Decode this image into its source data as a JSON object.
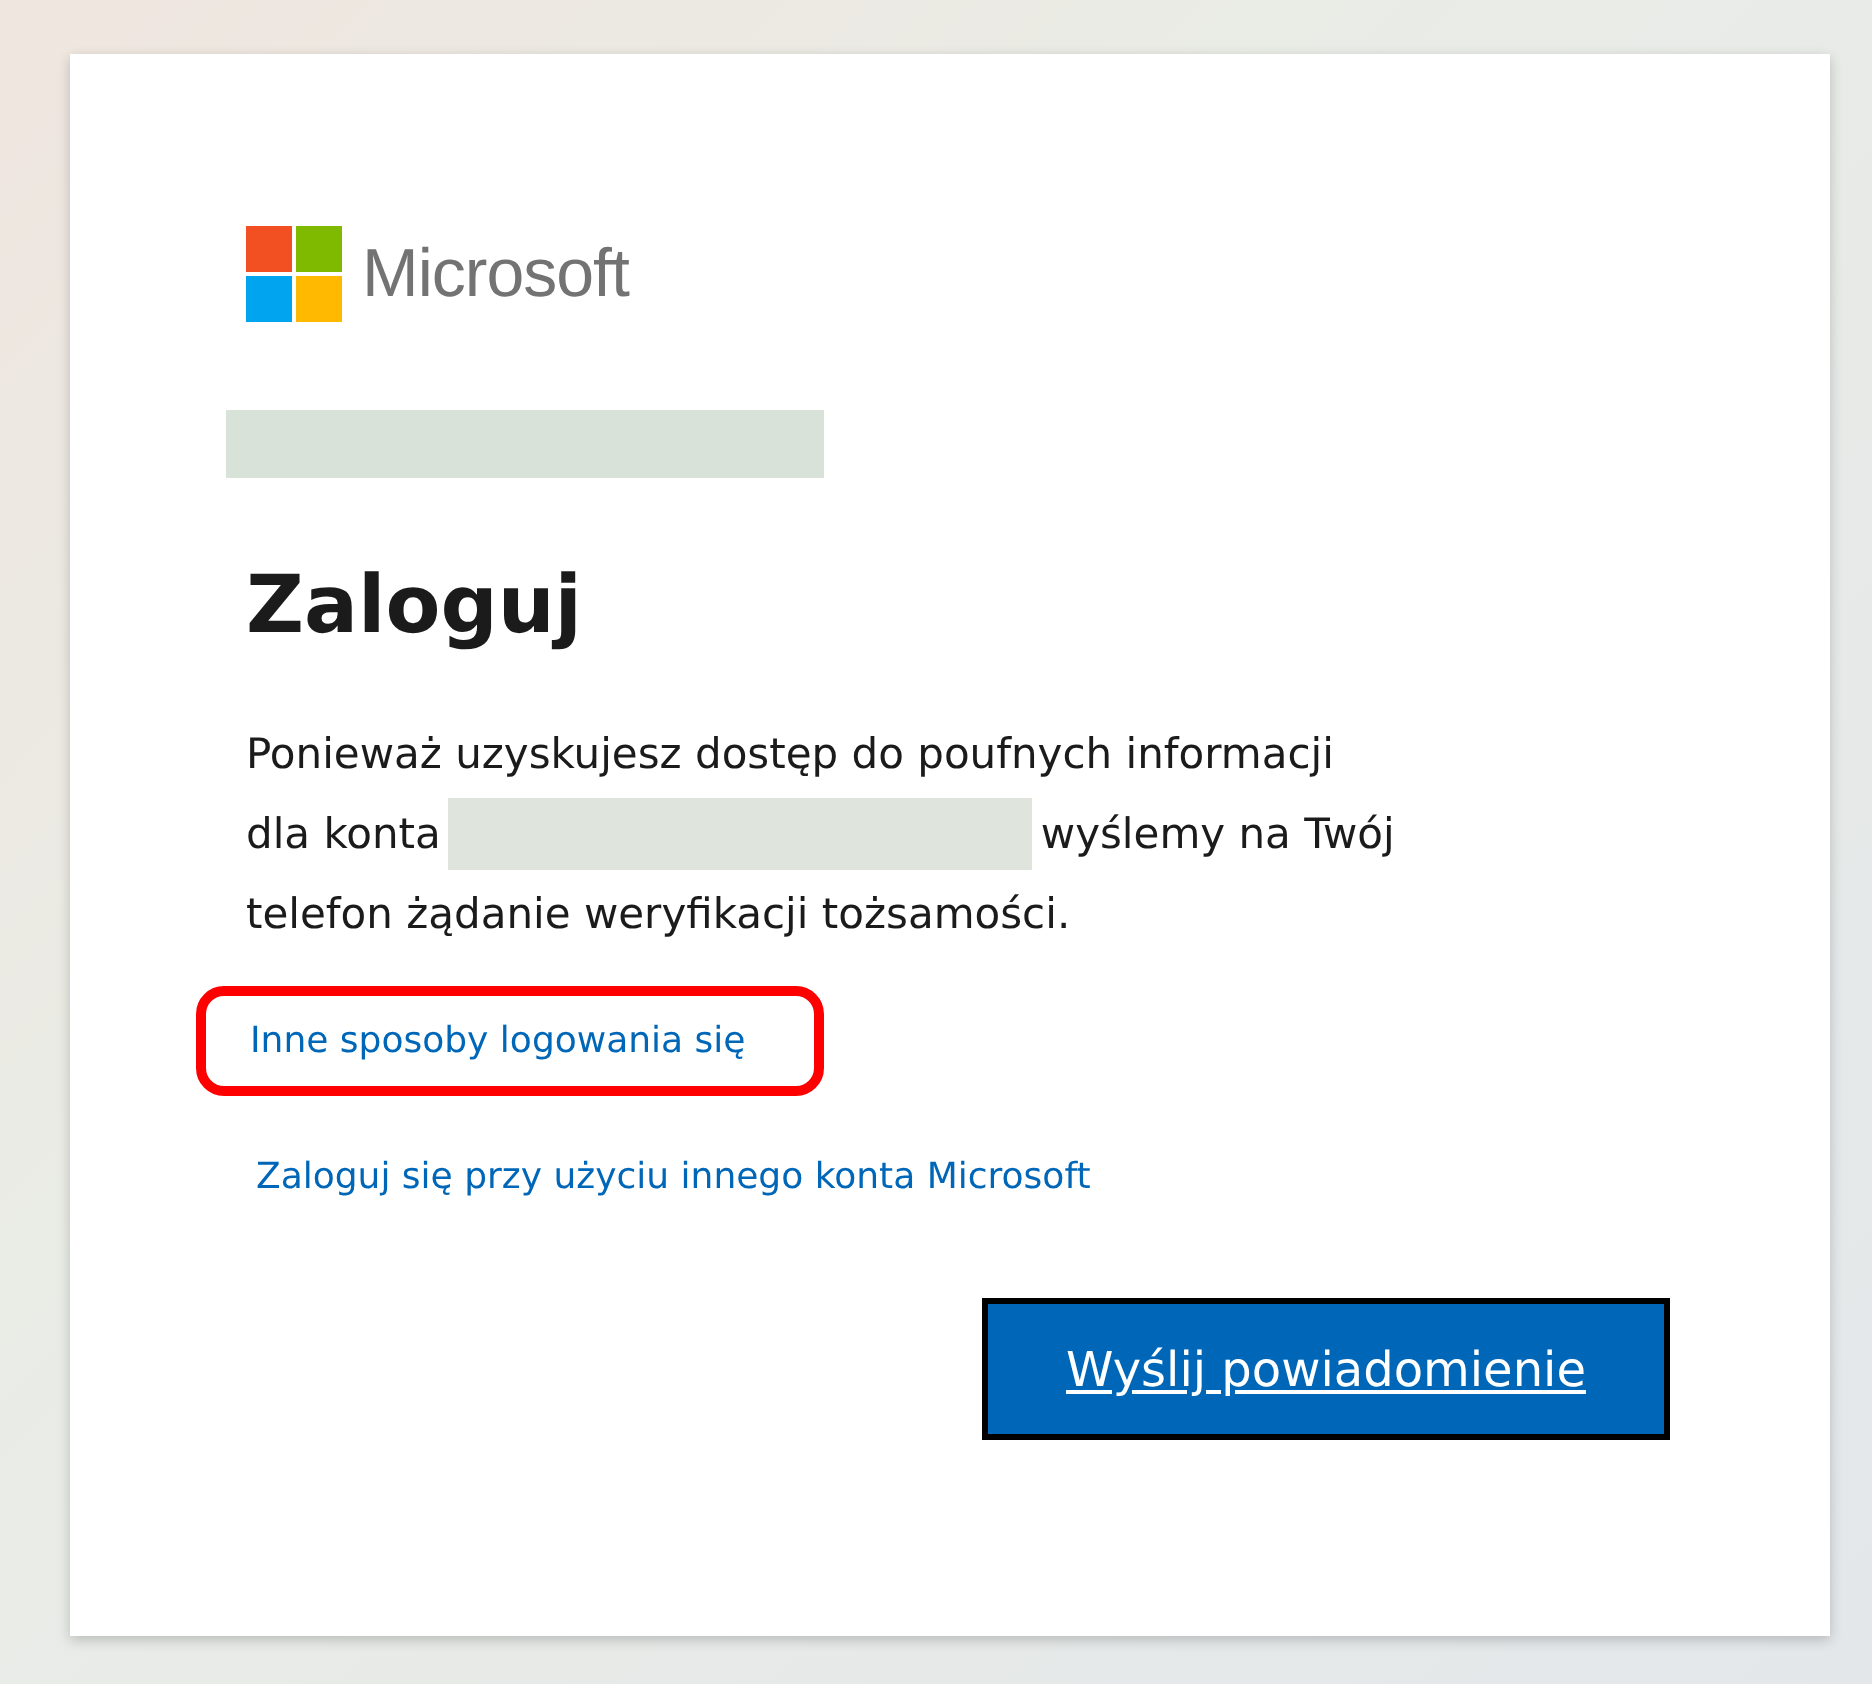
{
  "logo": {
    "text": "Microsoft"
  },
  "account": {
    "redacted": true
  },
  "title": "Zaloguj",
  "message": [
    [
      {
        "kind": "text",
        "text": "Ponieważ uzyskujesz dostęp do poufnych informacji"
      }
    ],
    [
      {
        "kind": "text",
        "text": "dla konta"
      },
      {
        "kind": "redacted"
      },
      {
        "kind": "text",
        "text": "wyślemy na Twój"
      }
    ],
    [
      {
        "kind": "text",
        "text": "telefon żądanie weryfikacji tożsamości."
      }
    ]
  ],
  "links": [
    {
      "text": "Inne sposoby logowania się",
      "highlighted": true
    },
    {
      "text": "Zaloguj się przy użyciu innego konta Microsoft",
      "highlighted": false
    }
  ],
  "button": {
    "label": "Wyślij powiadomienie"
  }
}
